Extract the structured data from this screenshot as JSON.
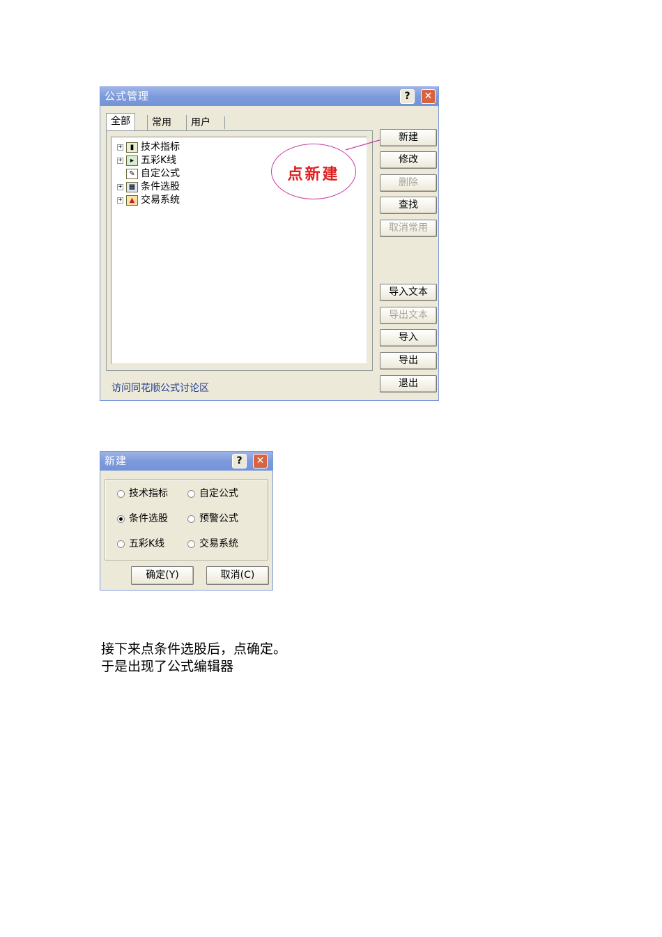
{
  "formula_manager": {
    "title": "公式管理",
    "help_glyph": "?",
    "close_glyph": "✕",
    "tabs": [
      "全部",
      "常用",
      "用户"
    ],
    "tree": [
      {
        "label": "技术指标",
        "expandable": true,
        "icon": "bar-chart-icon"
      },
      {
        "label": "五彩K线",
        "expandable": true,
        "icon": "kline-icon"
      },
      {
        "label": "自定公式",
        "expandable": false,
        "icon": "pencil-icon"
      },
      {
        "label": "条件选股",
        "expandable": true,
        "icon": "stock-selection-icon"
      },
      {
        "label": "交易系统",
        "expandable": true,
        "icon": "up-arrow-icon"
      }
    ],
    "annotation": "点新建",
    "buttons": {
      "new": "新建",
      "modify": "修改",
      "delete": "删除",
      "find": "查找",
      "cancel_common": "取消常用",
      "import_text": "导入文本",
      "export_text": "导出文本",
      "import": "导入",
      "export": "导出",
      "exit": "退出"
    },
    "footer_link": "访问同花顺公式讨论区"
  },
  "new_dialog": {
    "title": "新建",
    "help_glyph": "?",
    "close_glyph": "✕",
    "options": [
      {
        "label": "技术指标",
        "checked": false
      },
      {
        "label": "自定公式",
        "checked": false
      },
      {
        "label": "条件选股",
        "checked": true
      },
      {
        "label": "预警公式",
        "checked": false
      },
      {
        "label": "五彩K线",
        "checked": false
      },
      {
        "label": "交易系统",
        "checked": false
      }
    ],
    "ok": "确定(Y)",
    "cancel": "取消(C)"
  },
  "caption": {
    "line1": "接下来点条件选股后，点确定。",
    "line2": "于是出现了公式编辑器"
  }
}
